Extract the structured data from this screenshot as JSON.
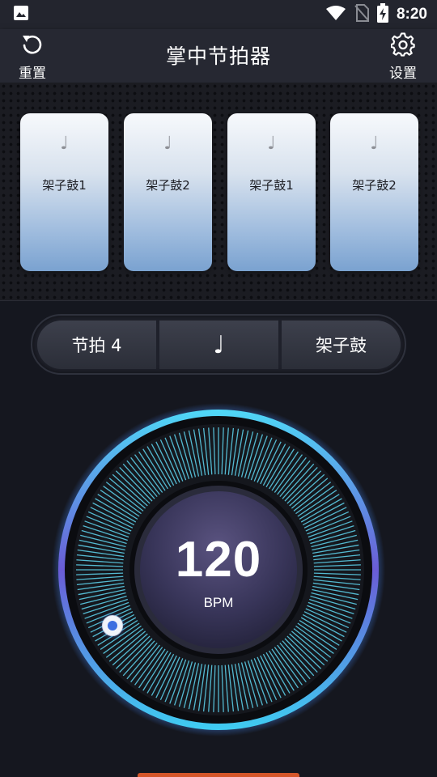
{
  "status_bar": {
    "time": "8:20",
    "icons": [
      "image-icon",
      "wifi-icon",
      "no-sim-icon",
      "battery-charging-icon"
    ]
  },
  "header": {
    "title": "掌中节拍器",
    "reset_label": "重置",
    "settings_label": "设置"
  },
  "pads": [
    {
      "note": "♩",
      "label": "架子鼓1"
    },
    {
      "note": "♩",
      "label": "架子鼓2"
    },
    {
      "note": "♩",
      "label": "架子鼓1"
    },
    {
      "note": "♩",
      "label": "架子鼓2"
    }
  ],
  "selector": {
    "beats_label": "节拍 4",
    "note_symbol": "♩",
    "instrument_label": "架子鼓"
  },
  "dial": {
    "bpm": "120",
    "unit": "BPM"
  },
  "colors": {
    "background": "#15171f",
    "pad_top": "#f7f9fc",
    "pad_bottom": "#7aa2d0",
    "tick_cyan": "#5fd6f0",
    "ring_purple": "#6a5cd6",
    "ring_cyan": "#45d2f5",
    "knob_blue": "#3d6fe0"
  }
}
